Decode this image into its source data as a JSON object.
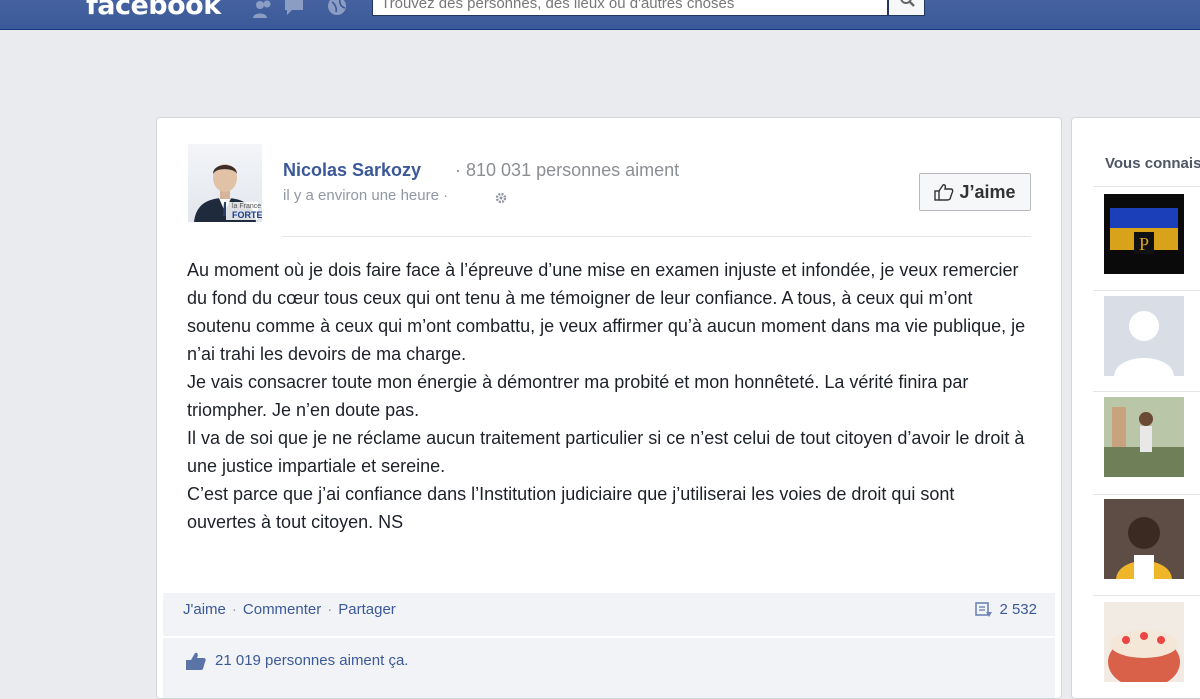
{
  "topbar": {
    "logo": "facebook",
    "search_placeholder": "Trouvez des personnes, des lieux ou d'autres choses"
  },
  "post": {
    "page_name": "Nicolas Sarkozy",
    "separator": "·",
    "likes_count": "810 031 personnes aiment",
    "timestamp": "il y a environ une heure ·",
    "like_button": "J’aime",
    "avatar_caption_1": "la France",
    "avatar_caption_2": "FORTE",
    "paragraphs": [
      "Au moment où je dois faire face à l’épreuve d’une mise en examen injuste et infondée, je veux remercier du fond du cœur tous ceux qui ont tenu à me témoigner de leur confiance. A tous, à ceux qui m’ont soutenu comme à ceux qui m’ont combattu, je veux affirmer qu’à aucun moment dans ma vie publique, je n’ai trahi les devoirs de ma charge.",
      "Je vais consacrer toute mon énergie à démontrer ma probité et mon honnêteté. La vérité finira par triompher. Je n’en doute pas.",
      "Il va de soi que je ne réclame aucun traitement particulier si ce n’est celui de tout citoyen d’avoir le droit à une justice impartiale et sereine.",
      "C’est parce que j’ai confiance dans l’Institution judiciaire que j’utiliserai les voies de droit qui sont ouvertes à tout citoyen. NS"
    ],
    "actions": {
      "like": "J'aime",
      "comment": "Commenter",
      "share": "Partager",
      "dot": "·",
      "share_count": "2 532"
    },
    "likes_summary": "21 019 personnes aiment ça."
  },
  "sidebar": {
    "title": "Vous connaissez peut-être"
  },
  "colors": {
    "brand": "#3b5998",
    "background": "#e9ebee",
    "link": "#3b5998",
    "muted": "#9197a3"
  },
  "icons": [
    "friend-requests-icon",
    "messages-icon",
    "notifications-icon",
    "search-icon",
    "gear-icon",
    "thumbs-up-icon",
    "share-icon"
  ]
}
